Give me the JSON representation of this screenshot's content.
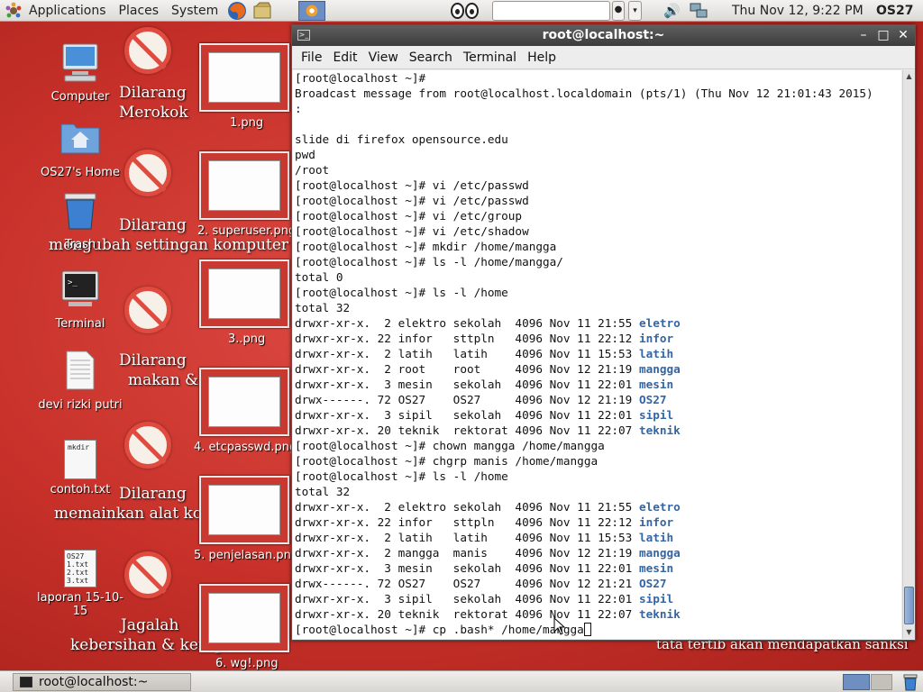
{
  "top_panel": {
    "menus": [
      "Applications",
      "Places",
      "System"
    ],
    "clock": "Thu Nov 12,  9:22 PM",
    "user": "OS27"
  },
  "desktop": {
    "icons": [
      {
        "label": "Computer"
      },
      {
        "label": "OS27's Home"
      },
      {
        "label": "Trash"
      },
      {
        "label": "Terminal"
      },
      {
        "label": "devi rizki putri"
      },
      {
        "label": "contoh.txt",
        "preview": "mkdir"
      },
      {
        "label": "laporan 15-10-15",
        "preview": "OS27\n1.txt\n2.txt\n3.txt"
      }
    ],
    "thumbnails": [
      {
        "label": "1.png"
      },
      {
        "label": "2. superuser.png"
      },
      {
        "label": "3..png"
      },
      {
        "label": "4. etcpasswd.png"
      },
      {
        "label": "5. penjelasan.png"
      },
      {
        "label": "6. wg!.png"
      }
    ],
    "wallpaper_text": [
      "Dilarang",
      "Merokok",
      "Dilarang",
      "mengubah settingan komputer",
      "Dilarang",
      "makan & minum",
      "Dilarang",
      "memainkan alat komu",
      "Jagalah",
      "kebersihan & kerapi",
      "tata tertib akan mendapatkan sanksi"
    ]
  },
  "terminal": {
    "title": "root@localhost:~",
    "menu": [
      "File",
      "Edit",
      "View",
      "Search",
      "Terminal",
      "Help"
    ],
    "lines": [
      {
        "t": "[root@localhost ~]#"
      },
      {
        "t": "Broadcast message from root@localhost.localdomain (pts/1) (Thu Nov 12 21:01:43 2015)"
      },
      {
        "t": ":"
      },
      {
        "t": ""
      },
      {
        "t": "slide di firefox opensource.edu"
      },
      {
        "t": "pwd"
      },
      {
        "t": "/root"
      },
      {
        "t": "[root@localhost ~]# vi /etc/passwd"
      },
      {
        "t": "[root@localhost ~]# vi /etc/passwd"
      },
      {
        "t": "[root@localhost ~]# vi /etc/group"
      },
      {
        "t": "[root@localhost ~]# vi /etc/shadow"
      },
      {
        "t": "[root@localhost ~]# mkdir /home/mangga"
      },
      {
        "t": "[root@localhost ~]# ls -l /home/mangga/"
      },
      {
        "t": "total 0"
      },
      {
        "t": "[root@localhost ~]# ls -l /home"
      },
      {
        "t": "total 32"
      },
      {
        "t": "drwxr-xr-x.  2 elektro sekolah  4096 Nov 11 21:55 ",
        "d": "eletro"
      },
      {
        "t": "drwxr-xr-x. 22 infor   sttpln   4096 Nov 11 22:12 ",
        "d": "infor"
      },
      {
        "t": "drwxr-xr-x.  2 latih   latih    4096 Nov 11 15:53 ",
        "d": "latih"
      },
      {
        "t": "drwxr-xr-x.  2 root    root     4096 Nov 12 21:19 ",
        "d": "mangga"
      },
      {
        "t": "drwxr-xr-x.  3 mesin   sekolah  4096 Nov 11 22:01 ",
        "d": "mesin"
      },
      {
        "t": "drwx------. 72 OS27    OS27     4096 Nov 12 21:19 ",
        "d": "OS27"
      },
      {
        "t": "drwxr-xr-x.  3 sipil   sekolah  4096 Nov 11 22:01 ",
        "d": "sipil"
      },
      {
        "t": "drwxr-xr-x. 20 teknik  rektorat 4096 Nov 11 22:07 ",
        "d": "teknik"
      },
      {
        "t": "[root@localhost ~]# chown mangga /home/mangga"
      },
      {
        "t": "[root@localhost ~]# chgrp manis /home/mangga"
      },
      {
        "t": "[root@localhost ~]# ls -l /home"
      },
      {
        "t": "total 32"
      },
      {
        "t": "drwxr-xr-x.  2 elektro sekolah  4096 Nov 11 21:55 ",
        "d": "eletro"
      },
      {
        "t": "drwxr-xr-x. 22 infor   sttpln   4096 Nov 11 22:12 ",
        "d": "infor"
      },
      {
        "t": "drwxr-xr-x.  2 latih   latih    4096 Nov 11 15:53 ",
        "d": "latih"
      },
      {
        "t": "drwxr-xr-x.  2 mangga  manis    4096 Nov 12 21:19 ",
        "d": "mangga"
      },
      {
        "t": "drwxr-xr-x.  3 mesin   sekolah  4096 Nov 11 22:01 ",
        "d": "mesin"
      },
      {
        "t": "drwx------. 72 OS27    OS27     4096 Nov 12 21:21 ",
        "d": "OS27"
      },
      {
        "t": "drwxr-xr-x.  3 sipil   sekolah  4096 Nov 11 22:01 ",
        "d": "sipil"
      },
      {
        "t": "drwxr-xr-x. 20 teknik  rektorat 4096 Nov 11 22:07 ",
        "d": "teknik"
      },
      {
        "t": "[root@localhost ~]# cp .bash* /home/mangga"
      }
    ]
  },
  "taskbar": {
    "window_button": "root@localhost:~"
  },
  "colors": {
    "directory": "#3465a4",
    "wallpaper": "#d0352f",
    "titlebar": "#4a4a4a"
  }
}
